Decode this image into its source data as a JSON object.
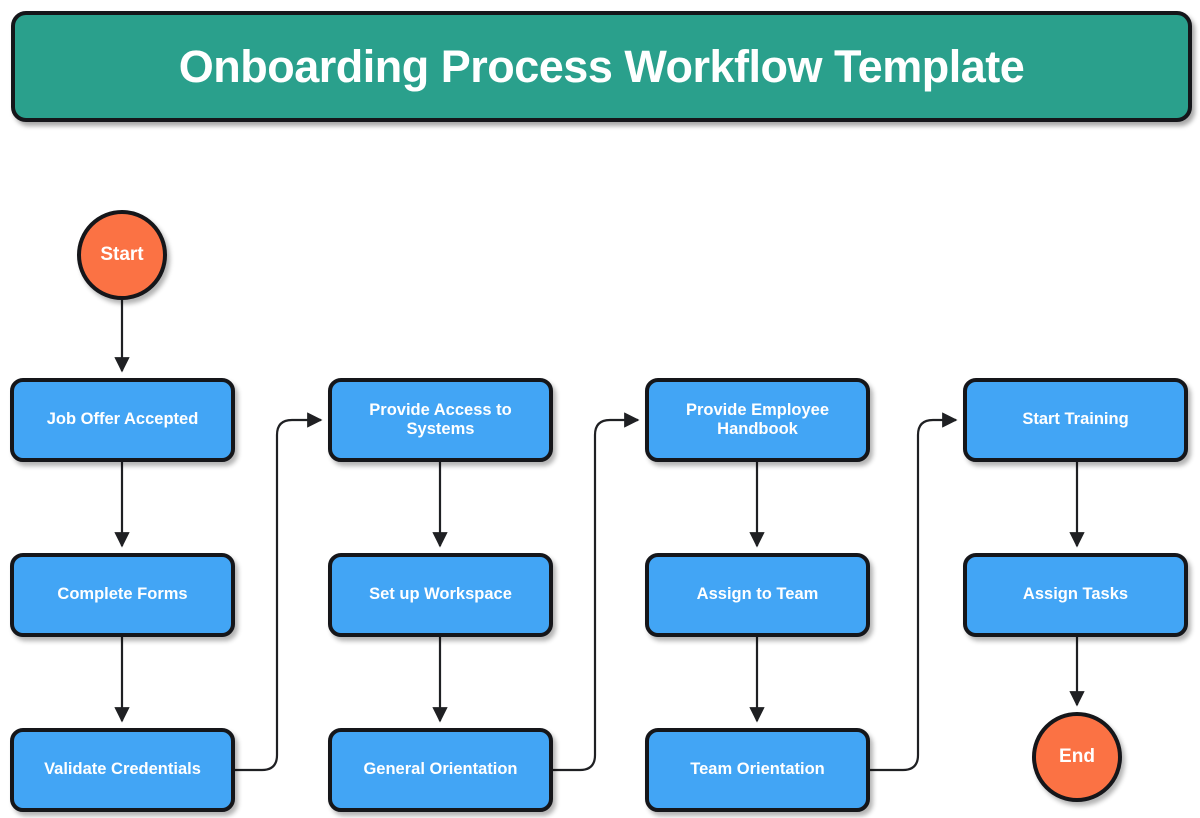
{
  "banner": {
    "title": "Onboarding Process Workflow Template",
    "background_color": "#2AA08C",
    "text_color": "#ffffff",
    "border_color": "#15161a"
  },
  "theme": {
    "process_fill": "#42A5F5",
    "terminator_fill": "#FB7244",
    "stroke": "#15161a",
    "connector": "#1f2023",
    "page_background": "#ffffff"
  },
  "chart_data": {
    "type": "diagram",
    "subtype": "flowchart",
    "title": "Onboarding Process Workflow Template",
    "orientation": "left-to-right columns, top-to-bottom within column",
    "nodes": [
      {
        "id": "start",
        "label": "Start",
        "shape": "circle",
        "fill": "#FB7244",
        "column": 1,
        "row": 0
      },
      {
        "id": "n1",
        "label": "Job Offer Accepted",
        "shape": "rounded-rectangle",
        "fill": "#42A5F5",
        "column": 1,
        "row": 1
      },
      {
        "id": "n2",
        "label": "Complete Forms",
        "shape": "rounded-rectangle",
        "fill": "#42A5F5",
        "column": 1,
        "row": 2
      },
      {
        "id": "n3",
        "label": "Validate Credentials",
        "shape": "rounded-rectangle",
        "fill": "#42A5F5",
        "column": 1,
        "row": 3
      },
      {
        "id": "n4",
        "label": "Provide Access to Systems",
        "shape": "rounded-rectangle",
        "fill": "#42A5F5",
        "column": 2,
        "row": 1
      },
      {
        "id": "n5",
        "label": "Set up Workspace",
        "shape": "rounded-rectangle",
        "fill": "#42A5F5",
        "column": 2,
        "row": 2
      },
      {
        "id": "n6",
        "label": "General Orientation",
        "shape": "rounded-rectangle",
        "fill": "#42A5F5",
        "column": 2,
        "row": 3
      },
      {
        "id": "n7",
        "label": "Provide Employee Handbook",
        "shape": "rounded-rectangle",
        "fill": "#42A5F5",
        "column": 3,
        "row": 1
      },
      {
        "id": "n8",
        "label": "Assign to Team",
        "shape": "rounded-rectangle",
        "fill": "#42A5F5",
        "column": 3,
        "row": 2
      },
      {
        "id": "n9",
        "label": "Team Orientation",
        "shape": "rounded-rectangle",
        "fill": "#42A5F5",
        "column": 3,
        "row": 3
      },
      {
        "id": "n10",
        "label": "Start Training",
        "shape": "rounded-rectangle",
        "fill": "#42A5F5",
        "column": 4,
        "row": 1
      },
      {
        "id": "n11",
        "label": "Assign Tasks",
        "shape": "rounded-rectangle",
        "fill": "#42A5F5",
        "column": 4,
        "row": 2
      },
      {
        "id": "end",
        "label": "End",
        "shape": "circle",
        "fill": "#FB7244",
        "column": 4,
        "row": 3
      }
    ],
    "edges": [
      {
        "from": "start",
        "to": "n1",
        "style": "straight-down"
      },
      {
        "from": "n1",
        "to": "n2",
        "style": "straight-down"
      },
      {
        "from": "n2",
        "to": "n3",
        "style": "straight-down"
      },
      {
        "from": "n3",
        "to": "n4",
        "style": "elbow-right-up"
      },
      {
        "from": "n4",
        "to": "n5",
        "style": "straight-down"
      },
      {
        "from": "n5",
        "to": "n6",
        "style": "straight-down"
      },
      {
        "from": "n6",
        "to": "n7",
        "style": "elbow-right-up"
      },
      {
        "from": "n7",
        "to": "n8",
        "style": "straight-down"
      },
      {
        "from": "n8",
        "to": "n9",
        "style": "straight-down"
      },
      {
        "from": "n9",
        "to": "n10",
        "style": "elbow-right-up"
      },
      {
        "from": "n10",
        "to": "n11",
        "style": "straight-down"
      },
      {
        "from": "n11",
        "to": "end",
        "style": "straight-down"
      }
    ]
  },
  "nodes": {
    "start": {
      "label": "Start"
    },
    "n1": {
      "label": "Job Offer Accepted"
    },
    "n2": {
      "label": "Complete Forms"
    },
    "n3": {
      "label": "Validate Credentials"
    },
    "n4": {
      "label": "Provide Access to Systems"
    },
    "n5": {
      "label": "Set up Workspace"
    },
    "n6": {
      "label": "General Orientation"
    },
    "n7": {
      "label": "Provide Employee Handbook"
    },
    "n8": {
      "label": "Assign to Team"
    },
    "n9": {
      "label": "Team Orientation"
    },
    "n10": {
      "label": "Start Training"
    },
    "n11": {
      "label": "Assign Tasks"
    },
    "end": {
      "label": "End"
    }
  }
}
